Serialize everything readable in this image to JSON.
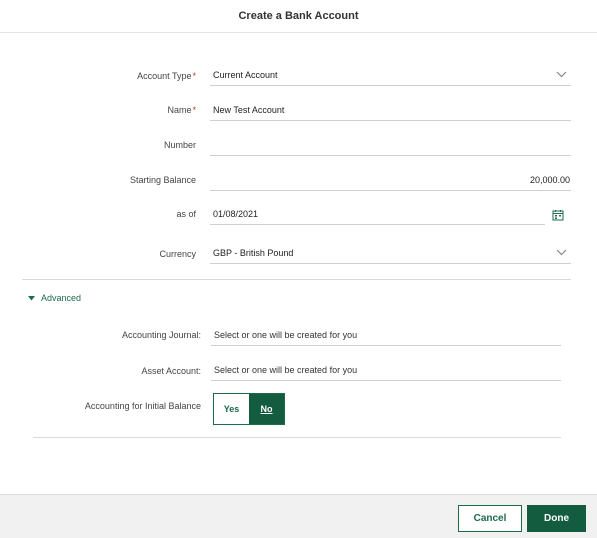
{
  "dialog": {
    "title": "Create a Bank Account"
  },
  "form": {
    "account_type": {
      "label": "Account Type",
      "required_mark": "*",
      "value": "Current Account"
    },
    "name": {
      "label": "Name",
      "required_mark": "*",
      "value": "New Test Account"
    },
    "number": {
      "label": "Number",
      "value": ""
    },
    "starting_balance": {
      "label": "Starting Balance",
      "value": "20,000.00"
    },
    "as_of": {
      "label": "as of",
      "value": "01/08/2021"
    },
    "currency": {
      "label": "Currency",
      "value": "GBP - British Pound"
    }
  },
  "advanced": {
    "toggle_label": "Advanced",
    "accounting_journal": {
      "label": "Accounting Journal:",
      "value": "Select or one will be created for you"
    },
    "asset_account": {
      "label": "Asset Account:",
      "value": "Select or one will be created for you"
    },
    "initial_balance": {
      "label": "Accounting for Initial Balance",
      "options": [
        "Yes",
        "No"
      ],
      "selected": "No"
    }
  },
  "footer": {
    "cancel_label": "Cancel",
    "done_label": "Done"
  },
  "colors": {
    "accent": "#145c40",
    "required": "#c0392b"
  },
  "icons": {
    "dropdown": "chevron-down-icon",
    "calendar": "calendar-icon",
    "disclosure": "caret-down-icon"
  }
}
